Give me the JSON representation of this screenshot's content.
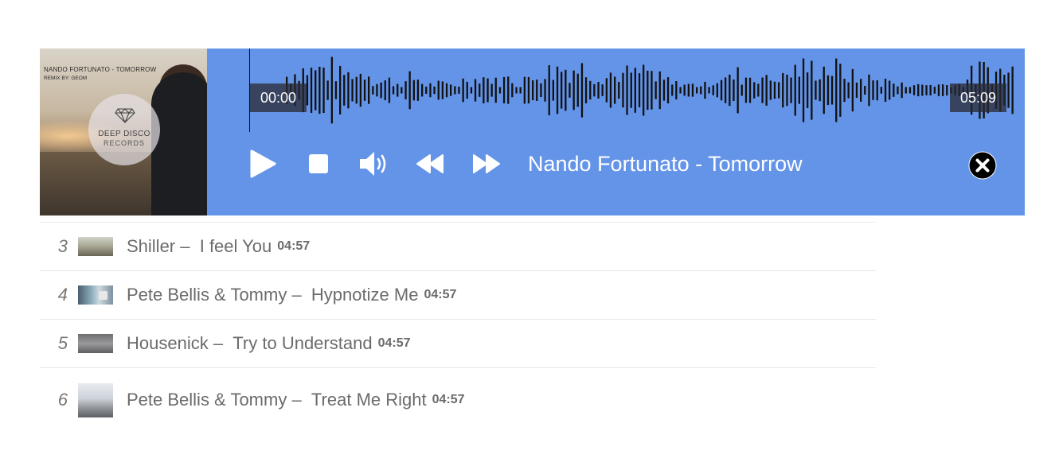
{
  "player": {
    "cover": {
      "title": "NANDO FORTUNATO - TOMORROW",
      "subtitle": "REMIX BY: GEOM",
      "label_line1": "DEEP DISCO",
      "label_line2": "RECORDS"
    },
    "current_time": "00:00",
    "total_time": "05:09",
    "progress": 0,
    "now_playing": "Nando Fortunato - Tomorrow",
    "controls": [
      "play-icon",
      "stop-icon",
      "volume-icon",
      "rewind-icon",
      "fast-forward-icon",
      "close-icon"
    ],
    "colors": {
      "bar_background": "#6494e8",
      "waveform": "#111111",
      "text": "#ffffff"
    }
  },
  "playlist": [
    {
      "number": "3",
      "artist": "Shiller",
      "title": "I feel You",
      "duration": "04:57"
    },
    {
      "number": "4",
      "artist": "Pete Bellis & Tommy",
      "title": "Hypnotize Me",
      "duration": "04:57"
    },
    {
      "number": "5",
      "artist": "Housenick",
      "title": "Try to Understand",
      "duration": "04:57"
    },
    {
      "number": "6",
      "artist": "Pete Bellis & Tommy",
      "title": "Treat Me Right",
      "duration": "04:57"
    }
  ],
  "separator": " –  "
}
